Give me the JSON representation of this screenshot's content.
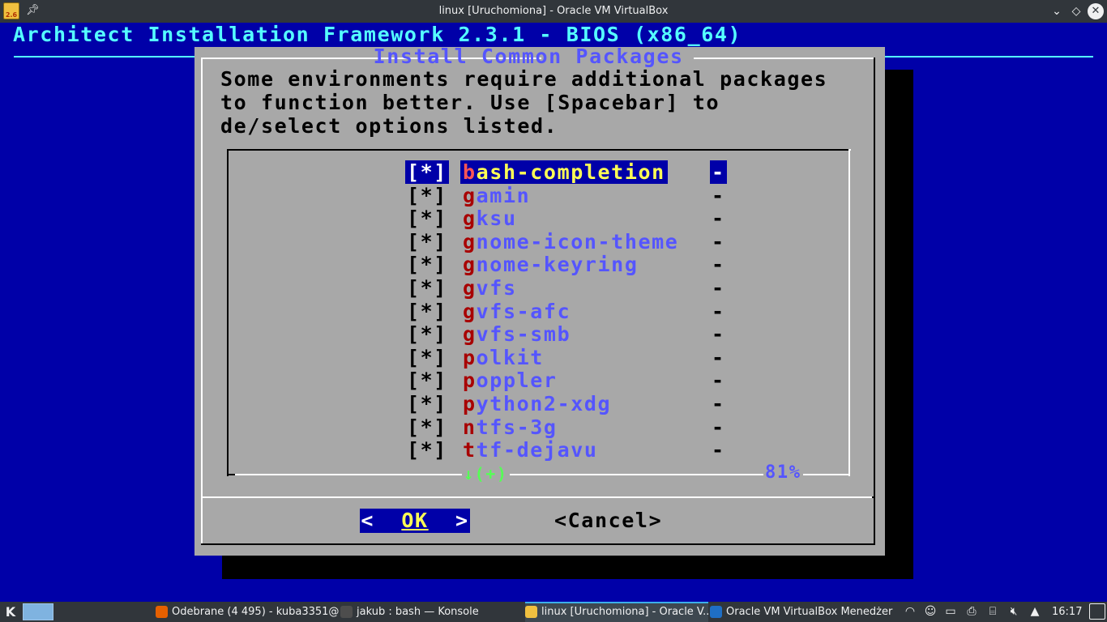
{
  "window": {
    "title": "linux [Uruchomiona] - Oracle VM VirtualBox",
    "app_icon_text": "2.6"
  },
  "vm": {
    "backtitle": "Architect Installation Framework 2.3.1 - BIOS (x86_64)",
    "dialog": {
      "title": "Install Common Packages",
      "prompt": "Some environments require additional packages\nto function better. Use [Spacebar] to\nde/select options listed.",
      "items": [
        {
          "check": "[*]",
          "hotkey": "b",
          "rest": "ash-completion",
          "desc": "-",
          "selected": true
        },
        {
          "check": "[*]",
          "hotkey": "g",
          "rest": "amin",
          "desc": "-",
          "selected": false
        },
        {
          "check": "[*]",
          "hotkey": "g",
          "rest": "ksu",
          "desc": "-",
          "selected": false
        },
        {
          "check": "[*]",
          "hotkey": "g",
          "rest": "nome-icon-theme",
          "desc": "-",
          "selected": false
        },
        {
          "check": "[*]",
          "hotkey": "g",
          "rest": "nome-keyring",
          "desc": "-",
          "selected": false
        },
        {
          "check": "[*]",
          "hotkey": "g",
          "rest": "vfs",
          "desc": "-",
          "selected": false
        },
        {
          "check": "[*]",
          "hotkey": "g",
          "rest": "vfs-afc",
          "desc": "-",
          "selected": false
        },
        {
          "check": "[*]",
          "hotkey": "g",
          "rest": "vfs-smb",
          "desc": "-",
          "selected": false
        },
        {
          "check": "[*]",
          "hotkey": "p",
          "rest": "olkit",
          "desc": "-",
          "selected": false
        },
        {
          "check": "[*]",
          "hotkey": "p",
          "rest": "oppler",
          "desc": "-",
          "selected": false
        },
        {
          "check": "[*]",
          "hotkey": "p",
          "rest": "ython2-xdg",
          "desc": "-",
          "selected": false
        },
        {
          "check": "[*]",
          "hotkey": "n",
          "rest": "tfs-3g",
          "desc": "-",
          "selected": false
        },
        {
          "check": "[*]",
          "hotkey": "t",
          "rest": "tf-dejavu",
          "desc": "-",
          "selected": false
        }
      ],
      "scroll_indicator": "↓(+)",
      "scroll_percent": "81%",
      "ok": {
        "left": "<",
        "label": "OK",
        "right": ">"
      },
      "cancel": {
        "left": "<",
        "label": "Cancel",
        "right": ">"
      }
    }
  },
  "taskbar": {
    "tasks": [
      {
        "label": "Odebrane (4 495) - kuba3351@...",
        "icon": "firefox-icon",
        "color": "#e66000"
      },
      {
        "label": "jakub : bash — Konsole",
        "icon": "terminal-icon",
        "color": "#4d4d4d"
      },
      {
        "label": "linux [Uruchomiona] - Oracle V...",
        "icon": "virtualbox-vm-icon",
        "color": "#f0c040"
      },
      {
        "label": "Oracle VM VirtualBox Menedżer",
        "icon": "virtualbox-icon",
        "color": "#1f6fc5"
      }
    ],
    "clock": "16:17"
  }
}
